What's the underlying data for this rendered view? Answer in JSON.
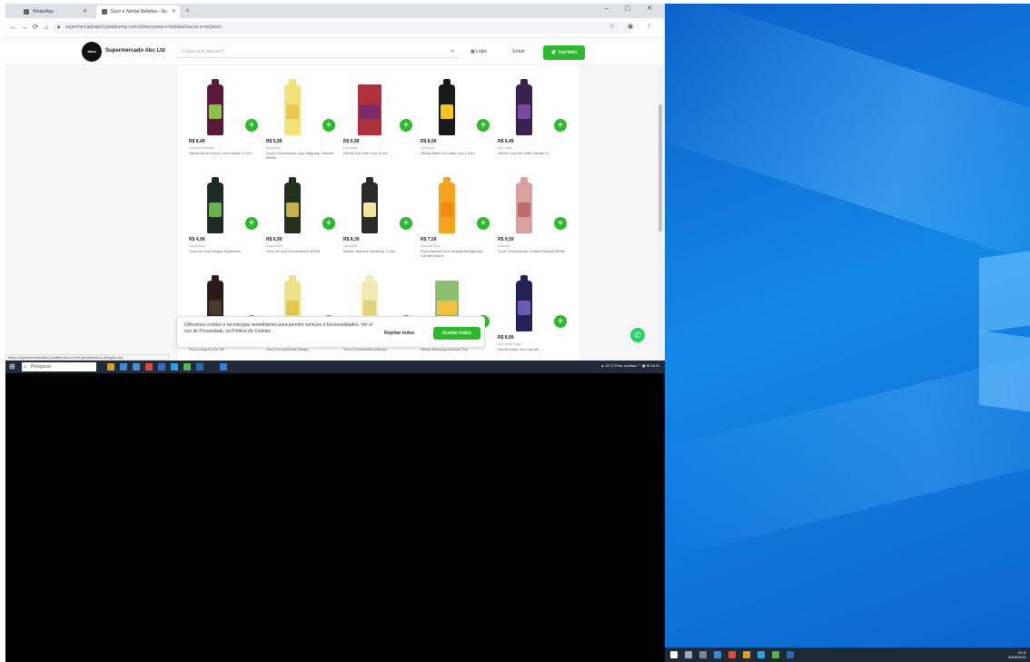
{
  "browser": {
    "tabs": [
      {
        "label": "WhatsApp"
      },
      {
        "label": "Suco e Néctar Bebidas - Su"
      }
    ],
    "new_tab": "+",
    "window_controls": "– ▢ ✕",
    "url": "supermercadoabcd.plataforma.com.br/mercearia-e-bebidas/sucos-e-nectares",
    "nav": {
      "back": "←",
      "forward": "→",
      "reload": "⟳",
      "home": "⌂"
    },
    "addr_icons": "☆ ◉ ⋮"
  },
  "header": {
    "logo": "abcd",
    "store_name": "Supermercado Abc Ltd",
    "search_placeholder": "O que você procura?",
    "links": [
      "Lojas",
      "Entrar"
    ],
    "cart_label": "Carrinho"
  },
  "products": [
    {
      "price": "R$ 8,49",
      "brand": "Aurora Bebidas",
      "name": "Néctar Aurora Uva Concentrado 1 Litro",
      "color": "#5a1a3a",
      "label": "#8bc34a",
      "shape": "bottle"
    },
    {
      "price": "R$ 5,99",
      "brand": "Maguary",
      "name": "Suco Concentrado Caju Maguary Garrafa 500ml",
      "color": "#f2e27a",
      "label": "#e8c84a",
      "shape": "bottle"
    },
    {
      "price": "R$ 6,99",
      "brand": "Del Valle",
      "name": "Néctar Del Valle Uva 1 Litro",
      "color": "#b0313d",
      "label": "#7a2a6a",
      "shape": "carton"
    },
    {
      "price": "R$ 8,99",
      "brand": "Del Valle",
      "name": "Néctar Misto Del Valle Uva 1 Litro",
      "color": "#1a1a1a",
      "label": "#f6c21c",
      "shape": "bottle"
    },
    {
      "price": "R$ 9,49",
      "brand": "Del Valle",
      "name": "Néctar Uva Del Valle Garrafa 1L",
      "color": "#3a2250",
      "label": "#7a4aa0",
      "shape": "bottle"
    },
    {
      "price": "R$ 4,99",
      "brand": "Superbom",
      "name": "Suco de Uva Integral Superbom",
      "color": "#1e2a24",
      "label": "#6bb04a",
      "shape": "bottle"
    },
    {
      "price": "R$ 6,99",
      "brand": "Superbom",
      "name": "Suco de Uva Concentrado 500ml",
      "color": "#24301e",
      "label": "#c8b04a",
      "shape": "bottle"
    },
    {
      "price": "R$ 8,39",
      "brand": "Jasmine",
      "name": "Néctar Jasmine Maracujá 1 Litro",
      "color": "#2a2a2a",
      "label": "#f4e4a0",
      "shape": "bottle"
    },
    {
      "price": "R$ 7,59",
      "brand": "Natural One",
      "name": "Suco Natural One Laranja Refrigerado Garrafa 900ml",
      "color": "#f5a21c",
      "label": "#f08a10",
      "shape": "bottle"
    },
    {
      "price": "R$ 9,59",
      "brand": "Sufresh",
      "name": "Suco Concentrado Goiaba Sufresh 900ml",
      "color": "#d9a0a0",
      "label": "#c06a6a",
      "shape": "bottle"
    },
    {
      "price": "",
      "brand": "",
      "name": "Suco Integral Uva Tial",
      "color": "#2a1a1a",
      "label": "#4a3a2a",
      "shape": "bottle"
    },
    {
      "price": "",
      "brand": "",
      "name": "Suco Concentrado Manga",
      "color": "#efe08a",
      "label": "#e4c64a",
      "shape": "bottle"
    },
    {
      "price": "",
      "brand": "",
      "name": "Suco Concentrado Abacaxi",
      "color": "#f2eab0",
      "label": "#e0d27a",
      "shape": "bottle"
    },
    {
      "price": "",
      "brand": "",
      "name": "Néctar Maracujá Natural One",
      "color": "#8cc070",
      "label": "#f0c040",
      "shape": "carton"
    },
    {
      "price": "R$ 8,99",
      "brand": "Del Valle Kapo",
      "name": "Néctar Kapo Uva Garrafa",
      "color": "#222255",
      "label": "#6a5ab0",
      "shape": "bottle"
    }
  ],
  "cookie": {
    "text": "Utilizamos cookies e tecnologias semelhantes para permitir serviços e funcionalidades. Ver el nos de Privacidade, ou Política de Cookies",
    "reject": "Rejeitar todos",
    "accept": "Aceitar todos"
  },
  "status_url": "https://supermercadoabcd.plataforma.com.br/produto/suco-integral-uva",
  "taskbar": {
    "search_placeholder": "Pesquisar",
    "tray": "▲ 21°C Pred. nublado  ⌃ ▣ ⊕  18:11",
    "clock_time": "18:11",
    "clock_date": "30/06/2021"
  },
  "colors": {
    "accent": "#2eb82e",
    "desktop": "#1488e6"
  }
}
